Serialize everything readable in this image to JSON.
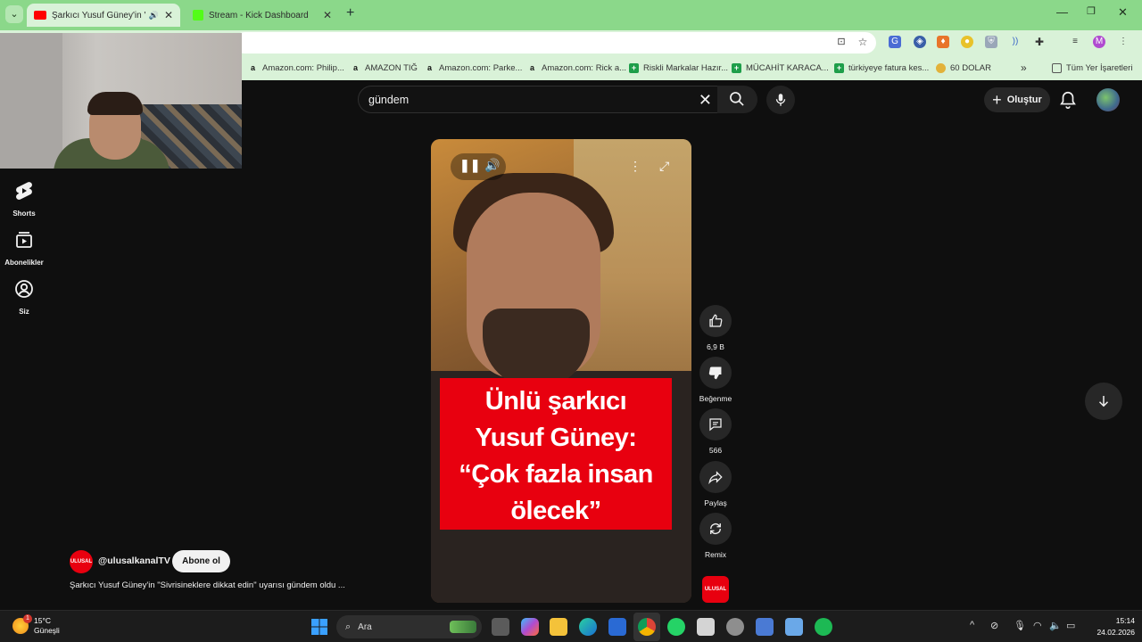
{
  "browser": {
    "tabs": [
      {
        "title": "Şarkıcı Yusuf Güney'in \"Sivri",
        "favicon_color": "#ff0000",
        "active": true
      },
      {
        "title": "Stream - Kick Dashboard",
        "favicon_color": "#53fc18",
        "active": false
      }
    ],
    "new_tab_label": "+",
    "bookmarks": [
      {
        "label": "Amazon.com: Philip...",
        "icon": "a"
      },
      {
        "label": "AMAZON TIĞ",
        "icon": "a"
      },
      {
        "label": "Amazon.com: Parke...",
        "icon": "a"
      },
      {
        "label": "Amazon.com: Rick a...",
        "icon": "a"
      },
      {
        "label": "Riskli Markalar Hazır...",
        "icon": "+"
      },
      {
        "label": "MÜCAHİT KARACA...",
        "icon": "+"
      },
      {
        "label": "türkiyeye fatura kes...",
        "icon": "+"
      },
      {
        "label": "60 DOLAR",
        "icon": "coin"
      }
    ],
    "bookmarks_overflow": "»",
    "all_bookmarks": "Tüm Yer İşaretleri",
    "profile_initial": "M"
  },
  "youtube": {
    "nav": [
      {
        "label": "Shorts",
        "icon": "shorts-icon"
      },
      {
        "label": "Abonelikler",
        "icon": "subscriptions-icon"
      },
      {
        "label": "Siz",
        "icon": "account-icon"
      }
    ],
    "search": {
      "value": "gündem"
    },
    "create_label": "Oluştur"
  },
  "video": {
    "caption_lines": [
      "Ünlü şarkıcı",
      "Yusuf Güney:",
      "“Çok fazla insan",
      "ölecek”"
    ],
    "actions": [
      {
        "label": "6,9 B",
        "icon": "like-icon"
      },
      {
        "label": "Beğenme",
        "icon": "dislike-icon"
      },
      {
        "label": "566",
        "icon": "comment-icon"
      },
      {
        "label": "Paylaş",
        "icon": "share-icon"
      },
      {
        "label": "Remix",
        "icon": "remix-icon"
      }
    ],
    "channel_badge": "ULUSAL"
  },
  "channel": {
    "handle": "@ulusalkanalTV",
    "subscribe_label": "Abone ol",
    "video_title": "Şarkıcı Yusuf Güney'in \"Sivrisineklere dikkat edin\" uyarısı gündem oldu ..."
  },
  "taskbar": {
    "weather_temp": "15°C",
    "weather_desc": "Güneşli",
    "weather_badge": "1",
    "search_label": "Ara",
    "time": "15:14",
    "date": "24.02.2026"
  }
}
